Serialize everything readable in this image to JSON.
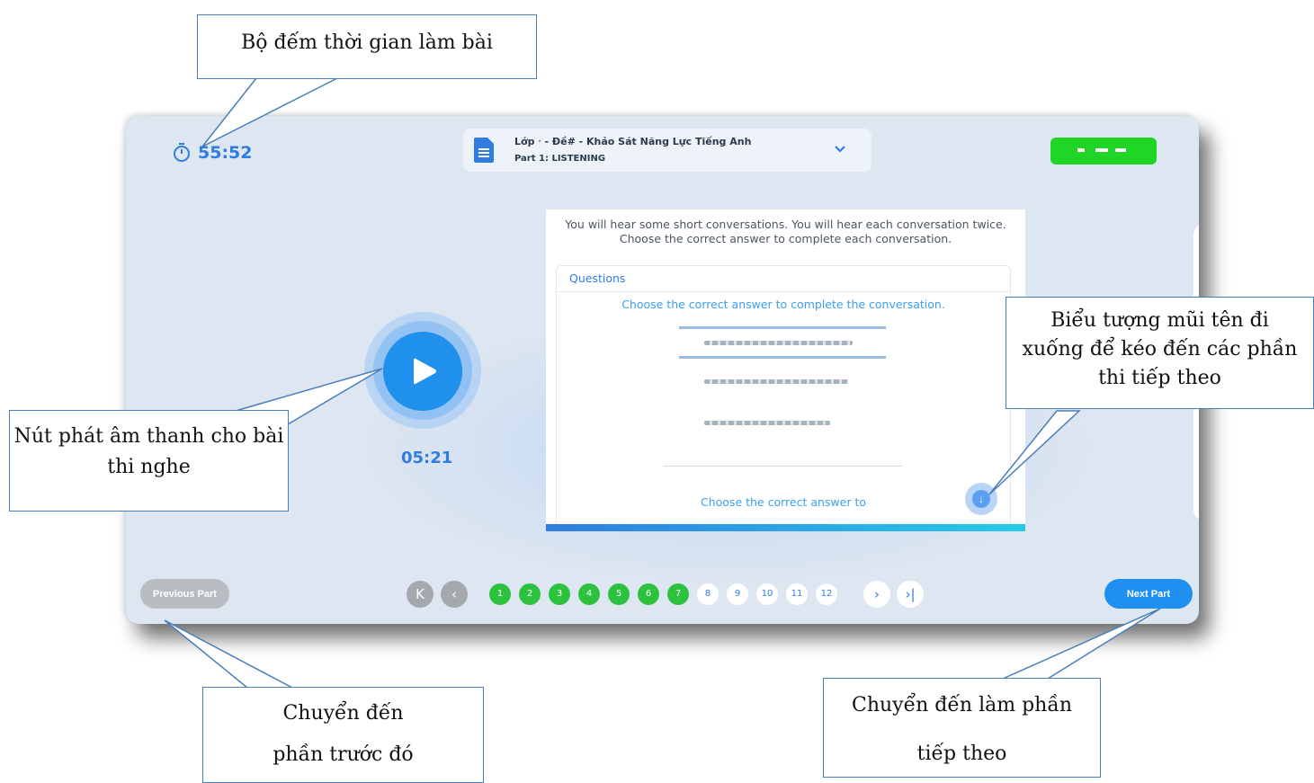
{
  "app": {
    "timer": "55:52",
    "exam_title": "Lớp ᐧ - Đề# - Khảo Sát Năng Lực Tiếng Anh",
    "part_title": "Part 1: LISTENING",
    "audio_duration": "05:21",
    "instructions": "You will hear some short conversations. You will hear each conversation twice. Choose the correct answer to complete each conversation.",
    "questions_tab": "Questions",
    "question_1_prompt": "Choose the correct answer to complete the conversation.",
    "question_2_prompt": "Choose the correct answer to",
    "scroll_icon": "↓",
    "prev_button": "Previous Part",
    "next_button": "Next Part",
    "pages": [
      {
        "label": "1",
        "status": "done"
      },
      {
        "label": "2",
        "status": "done"
      },
      {
        "label": "3",
        "status": "done"
      },
      {
        "label": "4",
        "status": "done"
      },
      {
        "label": "5",
        "status": "done"
      },
      {
        "label": "6",
        "status": "done"
      },
      {
        "label": "7",
        "status": "done"
      },
      {
        "label": "8",
        "status": "todo"
      },
      {
        "label": "9",
        "status": "todo"
      },
      {
        "label": "10",
        "status": "todo"
      },
      {
        "label": "11",
        "status": "todo"
      },
      {
        "label": "12",
        "status": "todo"
      }
    ],
    "nav_first": "K",
    "nav_prev": "‹",
    "nav_next": "›",
    "nav_last": "›|",
    "icons": [
      "stopwatch-icon",
      "document-icon",
      "chevron-down-icon",
      "play-icon",
      "arrow-down-icon"
    ],
    "colors": {
      "accent": "#2f7de1",
      "done": "#2cc23d",
      "user_badge": "#1fd626"
    }
  },
  "callouts": {
    "timer": "Bộ đếm thời gian làm bài",
    "play": "Nút phát âm thanh cho bài thi nghe",
    "scroll": "Biểu tượng mũi tên đi xuống để kéo đến các phần thi tiếp theo",
    "prev": "Chuyển đến phần trước đó",
    "next": "Chuyển đến làm phần tiếp theo"
  }
}
